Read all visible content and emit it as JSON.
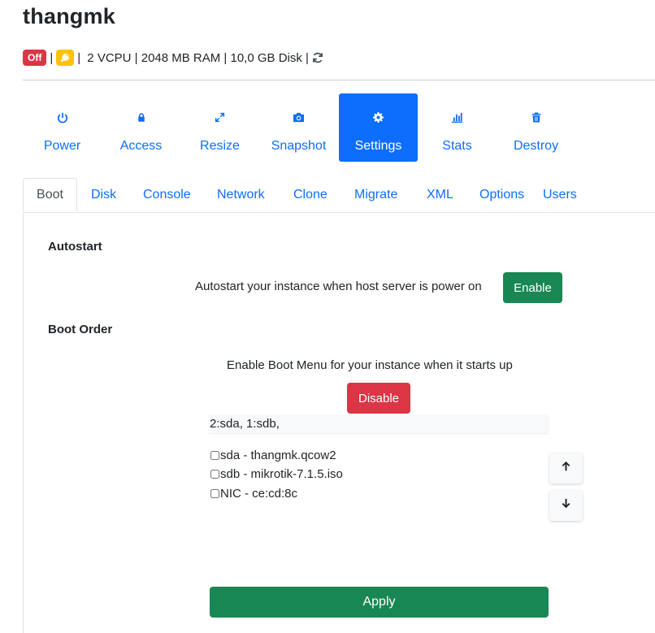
{
  "header": {
    "title": "thangmk",
    "status_badge": "Off",
    "separator": "|",
    "info_text": " 2 VCPU | 2048 MB RAM | 10,0 GB Disk ",
    "icons": [
      "plug-icon",
      "refresh-icon"
    ],
    "colors": {
      "off": "#dc3545",
      "power": "#ffc107"
    }
  },
  "actions": [
    {
      "label": "Power",
      "icon": "power-icon"
    },
    {
      "label": "Access",
      "icon": "lock-icon"
    },
    {
      "label": "Resize",
      "icon": "expand-icon"
    },
    {
      "label": "Snapshot",
      "icon": "camera-icon"
    },
    {
      "label": "Settings",
      "icon": "gear-icon",
      "active": true
    },
    {
      "label": "Stats",
      "icon": "bar-chart-icon"
    },
    {
      "label": "Destroy",
      "icon": "trash-icon"
    }
  ],
  "tabs": [
    {
      "label": "Boot",
      "active": true
    },
    {
      "label": "Disk"
    },
    {
      "label": "Console"
    },
    {
      "label": "Network"
    },
    {
      "label": "Clone"
    },
    {
      "label": "Migrate"
    },
    {
      "label": "XML"
    },
    {
      "label": "Options"
    },
    {
      "label": "Users"
    }
  ],
  "boot": {
    "autostart_heading": "Autostart",
    "autostart_desc": "Autostart your instance when host server is power on",
    "enable_label": "Enable",
    "boot_order_heading": "Boot Order",
    "boot_menu_desc": "Enable Boot Menu for your instance when it starts up",
    "disable_label": "Disable",
    "order_value": "2:sda, 1:sdb,",
    "devices": [
      {
        "label": "sda - thangmk.qcow2",
        "checked": false
      },
      {
        "label": "sdb - mikrotik-7.1.5.iso",
        "checked": false
      },
      {
        "label": "NIC - ce:cd:8c",
        "checked": false
      }
    ],
    "move_up_icon": "arrow-up-icon",
    "move_down_icon": "arrow-down-icon",
    "apply_label": "Apply",
    "colors": {
      "primary": "#0d6efd",
      "success": "#198754",
      "danger": "#dc3545"
    }
  }
}
